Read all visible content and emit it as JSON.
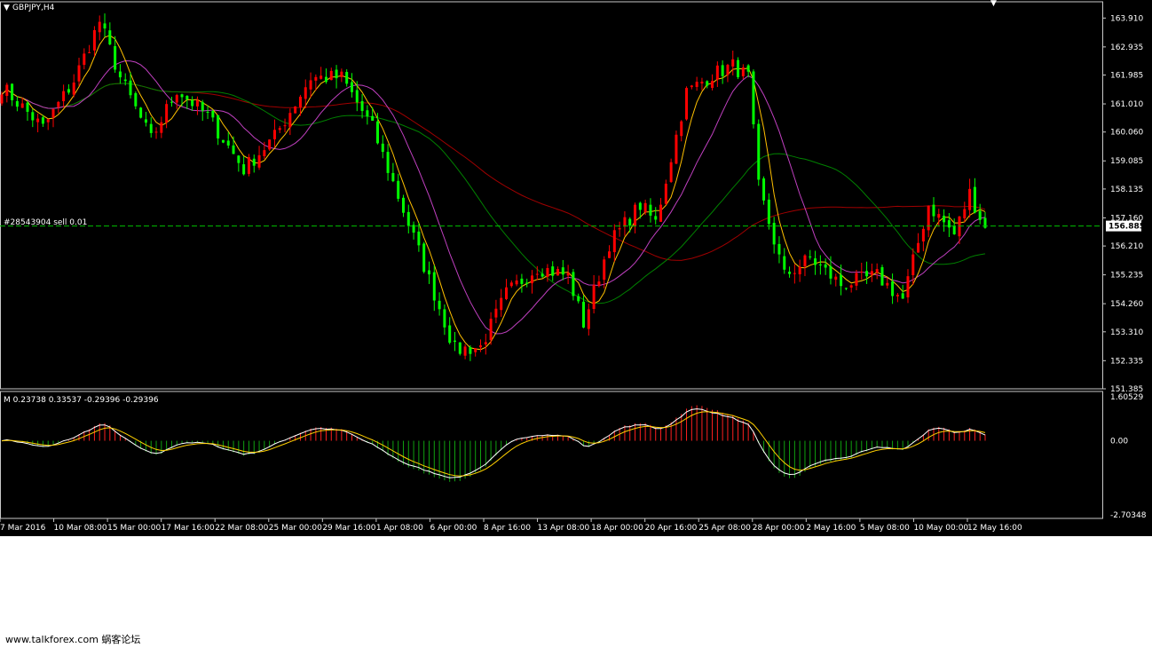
{
  "window": {
    "title": "GBPJPY,H4",
    "order_line_label": "#28543904 sell 0.01",
    "current_price": "156.885",
    "watermark": "www.talkforex.com 蜗客论坛"
  },
  "colors": {
    "background": "#000000",
    "bull_candle": "#ff0000",
    "bear_candle": "#00ff00",
    "ma_fast": "#ffc000",
    "ma_mid": "#c040c0",
    "ma_green": "#008000",
    "ma_red": "#a00000",
    "hist_up": "#ff2020",
    "hist_down": "#10a010",
    "macd_line": "#ffffff",
    "signal_line": "#ffd000",
    "order_line": "#00c000",
    "axis_text": "#ffffff"
  },
  "chart_data": [
    {
      "type": "candlestick",
      "title": "GBPJPY,H4",
      "ylim": [
        151.385,
        164.4
      ],
      "y_ticks": [
        "163.910",
        "162.935",
        "161.985",
        "161.010",
        "160.060",
        "159.085",
        "158.135",
        "157.160",
        "156.210",
        "155.235",
        "154.260",
        "153.310",
        "152.335",
        "151.385"
      ],
      "x_ticks": [
        "7 Mar 2016",
        "10 Mar 08:00",
        "15 Mar 00:00",
        "17 Mar 16:00",
        "22 Mar 08:00",
        "25 Mar 00:00",
        "29 Mar 16:00",
        "1 Apr 08:00",
        "6 Apr 00:00",
        "8 Apr 16:00",
        "13 Apr 08:00",
        "18 Apr 00:00",
        "20 Apr 16:00",
        "25 Apr 08:00",
        "28 Apr 00:00",
        "2 May 16:00",
        "5 May 08:00",
        "10 May 00:00",
        "12 May 16:00"
      ],
      "close_anchors": [
        {
          "bar": 0,
          "close": 161.6
        },
        {
          "bar": 8,
          "close": 160.2
        },
        {
          "bar": 14,
          "close": 161.8
        },
        {
          "bar": 19,
          "close": 163.8
        },
        {
          "bar": 23,
          "close": 161.9
        },
        {
          "bar": 29,
          "close": 159.8
        },
        {
          "bar": 34,
          "close": 161.5
        },
        {
          "bar": 40,
          "close": 160.6
        },
        {
          "bar": 47,
          "close": 158.8
        },
        {
          "bar": 53,
          "close": 159.9
        },
        {
          "bar": 60,
          "close": 161.9
        },
        {
          "bar": 66,
          "close": 161.9
        },
        {
          "bar": 72,
          "close": 160.2
        },
        {
          "bar": 80,
          "close": 156.5
        },
        {
          "bar": 88,
          "close": 152.7
        },
        {
          "bar": 93,
          "close": 152.8
        },
        {
          "bar": 98,
          "close": 154.6
        },
        {
          "bar": 104,
          "close": 155.5
        },
        {
          "bar": 110,
          "close": 155.2
        },
        {
          "bar": 113,
          "close": 153.6
        },
        {
          "bar": 118,
          "close": 156.3
        },
        {
          "bar": 124,
          "close": 157.6
        },
        {
          "bar": 127,
          "close": 157.0
        },
        {
          "bar": 133,
          "close": 161.4
        },
        {
          "bar": 138,
          "close": 162.0
        },
        {
          "bar": 142,
          "close": 162.3
        },
        {
          "bar": 145,
          "close": 161.9
        },
        {
          "bar": 147,
          "close": 158.2
        },
        {
          "bar": 152,
          "close": 155.2
        },
        {
          "bar": 157,
          "close": 155.8
        },
        {
          "bar": 163,
          "close": 154.9
        },
        {
          "bar": 170,
          "close": 155.2
        },
        {
          "bar": 175,
          "close": 154.4
        },
        {
          "bar": 180,
          "close": 157.6
        },
        {
          "bar": 185,
          "close": 156.6
        },
        {
          "bar": 188,
          "close": 158.0
        },
        {
          "bar": 190,
          "close": 157.2
        },
        {
          "bar": 191,
          "close": 156.8
        }
      ],
      "moving_averages": [
        {
          "period": 5,
          "color": "#ffc000"
        },
        {
          "period": 13,
          "color": "#c040c0"
        },
        {
          "period": 34,
          "color": "#008000"
        },
        {
          "period": 60,
          "color": "#a00000"
        }
      ],
      "order_level": 156.885
    },
    {
      "type": "histogram",
      "title": "M",
      "legend_values": "M 0.23738 0.33537 -0.29396 -0.29396",
      "ylim": [
        -2.70348,
        1.60529
      ],
      "y_ticks": [
        "1.60529",
        "0.00",
        "-2.70348"
      ]
    }
  ]
}
